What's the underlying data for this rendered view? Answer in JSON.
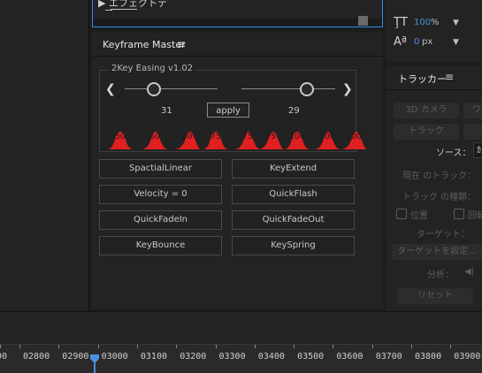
{
  "top_fragment": {
    "row1": "▶ エフェクトテ",
    "row2": ""
  },
  "keyframe_master": {
    "title": "Keyframe Master",
    "menu_glyph": "≡",
    "easing": {
      "legend": "2Key Easing v1.02",
      "left_arrow": "❮",
      "right_arrow": "❯",
      "left_value": "31",
      "right_value": "29",
      "left_fraction": 0.31,
      "right_fraction": 0.7,
      "apply_label": "apply",
      "presets": [
        "50",
        "50",
        "50",
        "75",
        "75",
        "75",
        "100",
        "100",
        "100"
      ]
    },
    "buttons": [
      "SpactialLinear",
      "KeyExtend",
      "Velocity = 0",
      "QuickFlash",
      "QuickFadeIn",
      "QuickFadeOut",
      "KeyBounce",
      "KeySpring"
    ]
  },
  "character": {
    "leading_glyph": "ŢT",
    "leading_value": "100",
    "leading_unit": "%",
    "baseline_glyph": "Aª",
    "baseline_value": "0",
    "baseline_unit": "px",
    "dropdown_glyph": "▼"
  },
  "tracker": {
    "title": "トラッカー",
    "menu_glyph": "≡",
    "btn_3d_camera": "3D カメラ",
    "btn_warp": "ワ",
    "btn_track": "トラック",
    "source_label": "ソース：",
    "source_value": "ｶ",
    "current_track_label": "現在 のトラック：",
    "track_type_label": "トラック の種類：",
    "position_label": "位置",
    "rotation_label": "回転",
    "target_label": "ターゲット：",
    "set_target_label": "ターゲットを設定...",
    "analyze_label": "分析：",
    "analyze_arrows": "◀|",
    "reset_label": "リセット"
  },
  "timeline": {
    "ruler_labels": [
      "00",
      "02800",
      "02900",
      "03000",
      "03100",
      "03200",
      "03300",
      "03400",
      "03500",
      "03600",
      "03700",
      "03800",
      "03900"
    ],
    "accent_color": "#4a8fe0"
  }
}
